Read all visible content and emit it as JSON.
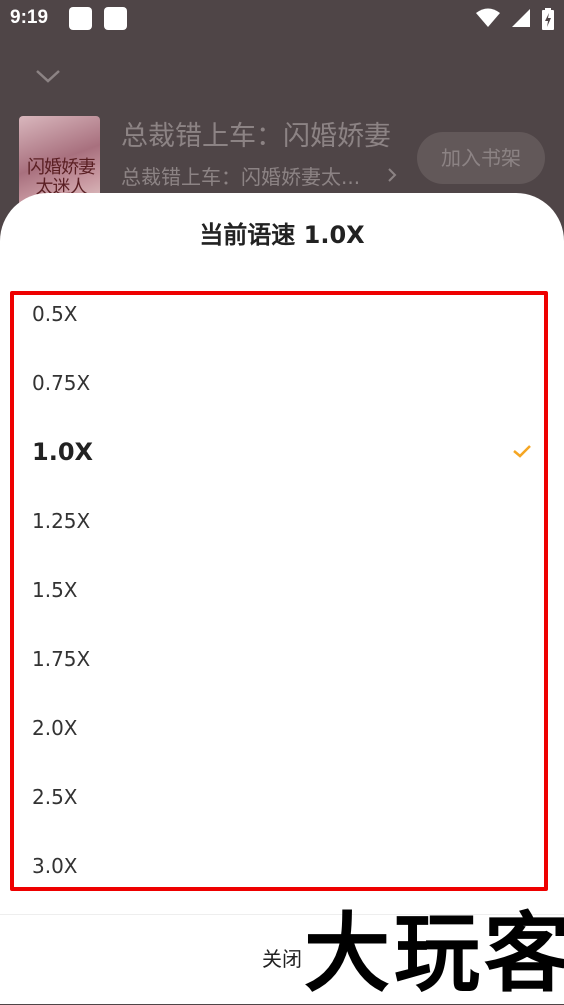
{
  "status_bar": {
    "time": "9:19",
    "icons": [
      "notification-square-icon",
      "notification-square-icon",
      "wifi-icon",
      "signal-icon",
      "battery-charging-icon"
    ]
  },
  "player": {
    "book_title": "总裁错上车：闪婚娇妻",
    "book_subtitle": "总裁错上车：闪婚娇妻太...",
    "cover_text": "闪婚娇妻太迷人",
    "add_shelf_label": "加入书架"
  },
  "speed_sheet": {
    "title": "当前语速 1.0X",
    "options": [
      {
        "label": "0.5X",
        "selected": false
      },
      {
        "label": "0.75X",
        "selected": false
      },
      {
        "label": "1.0X",
        "selected": true
      },
      {
        "label": "1.25X",
        "selected": false
      },
      {
        "label": "1.5X",
        "selected": false
      },
      {
        "label": "1.75X",
        "selected": false
      },
      {
        "label": "2.0X",
        "selected": false
      },
      {
        "label": "2.5X",
        "selected": false
      },
      {
        "label": "3.0X",
        "selected": false
      }
    ],
    "close_label": "关闭"
  },
  "watermark": "大玩客",
  "colors": {
    "accent_check": "#f5a623",
    "highlight_border": "#ee0000",
    "overlay": "#4f4547"
  }
}
